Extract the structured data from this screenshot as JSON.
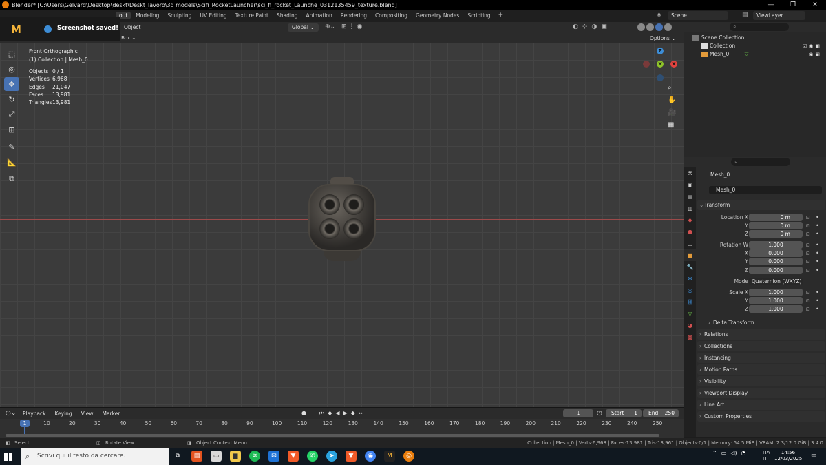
{
  "window": {
    "title": "Blender* [C:\\Users\\Gelvard\\Desktop\\deskt\\Deskt_lavoro\\3d models\\Scifi_RocketLauncher\\sci_fi_rocket_Launche_0312135459_texture.blend]"
  },
  "workspaces": [
    {
      "label": "out",
      "active": true
    },
    {
      "label": "Modeling"
    },
    {
      "label": "Sculpting"
    },
    {
      "label": "UV Editing"
    },
    {
      "label": "Texture Paint"
    },
    {
      "label": "Shading"
    },
    {
      "label": "Animation"
    },
    {
      "label": "Rendering"
    },
    {
      "label": "Compositing"
    },
    {
      "label": "Geometry Nodes"
    },
    {
      "label": "Scripting"
    }
  ],
  "workspace_add": "+",
  "scene": "Scene",
  "view_layer": "ViewLayer",
  "notification": {
    "message": "Screenshot saved!",
    "logo": "M"
  },
  "viewport_header": {
    "object_menu": "Object",
    "select_box": "ect Box",
    "orientation": "Global",
    "options": "Options"
  },
  "viewport": {
    "view_name": "Front Orthographic",
    "collection_line": "(1) Collection | Mesh_0",
    "stats": [
      {
        "k": "Objects",
        "v": "0 / 1"
      },
      {
        "k": "Vertices",
        "v": "6,968"
      },
      {
        "k": "Edges",
        "v": "21,047"
      },
      {
        "k": "Faces",
        "v": "13,981"
      },
      {
        "k": "Triangles",
        "v": "13,981"
      }
    ],
    "gizmo": {
      "z": "Z",
      "y": "Y",
      "x": "X"
    }
  },
  "outliner": {
    "scene_collection": "Scene Collection",
    "collection": "Collection",
    "mesh": "Mesh_0"
  },
  "properties": {
    "object_name": "Mesh_0",
    "data_name": "Mesh_0",
    "transform": "Transform",
    "location_label": "Location X",
    "rotation_label": "Rotation W",
    "scale_label": "Scale X",
    "y_label": "Y",
    "z_label": "Z",
    "x_label": "X",
    "location": [
      "0 m",
      "0 m",
      "0 m"
    ],
    "rotation": [
      "1.000",
      "0.000",
      "0.000",
      "0.000"
    ],
    "mode_label": "Mode",
    "mode_value": "Quaternion (WXYZ)",
    "scale": [
      "1.000",
      "1.000",
      "1.000"
    ],
    "delta_transform": "Delta Transform",
    "panels": [
      "Relations",
      "Collections",
      "Instancing",
      "Motion Paths",
      "Visibility",
      "Viewport Display",
      "Line Art",
      "Custom Properties"
    ]
  },
  "timeline": {
    "menus": [
      "Playback",
      "Keying",
      "View",
      "Marker"
    ],
    "current_frame": "1",
    "start_label": "Start",
    "start": "1",
    "end_label": "End",
    "end": "250",
    "ticks": [
      "1",
      "10",
      "20",
      "30",
      "40",
      "50",
      "60",
      "70",
      "80",
      "90",
      "100",
      "110",
      "120",
      "130",
      "140",
      "150",
      "160",
      "170",
      "180",
      "190",
      "200",
      "210",
      "220",
      "230",
      "240",
      "250"
    ]
  },
  "statusbar": {
    "select": "Select",
    "rotate": "Rotate View",
    "context": "Object Context Menu",
    "info": "Collection | Mesh_0 | Verts:6,968 | Faces:13,981 | Tris:13,961 | Objects:0/1 | Memory: 54.5 MiB | VRAM: 2.3/12.0 GiB | 3.4.0"
  },
  "taskbar": {
    "search_placeholder": "Scrivi qui il testo da cercare.",
    "lang": [
      "ITA",
      "IT"
    ],
    "time": "14:56",
    "date": "12/03/2025"
  },
  "colors": {
    "accent": "#4772b3",
    "x_axis": "#e0433f",
    "y_axis": "#8ec32a",
    "z_axis": "#3d8dd6"
  }
}
